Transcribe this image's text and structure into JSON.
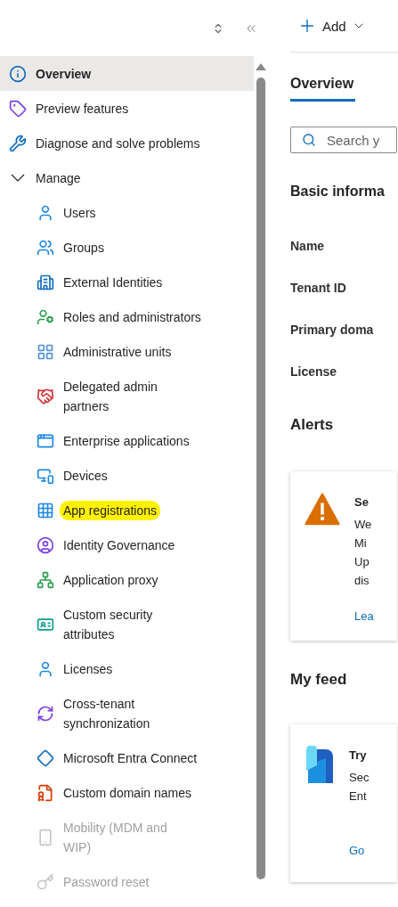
{
  "sidebar": {
    "items": [
      {
        "label": "Overview",
        "selected": true
      },
      {
        "label": "Preview features",
        "selected": false
      },
      {
        "label": "Diagnose and solve problems",
        "selected": false
      },
      {
        "label": "Manage",
        "selected": false,
        "expanded": true,
        "children": [
          {
            "label": "Users",
            "selected": false,
            "disabled": false,
            "highlighted": false
          },
          {
            "label": "Groups",
            "selected": false,
            "disabled": false,
            "highlighted": false
          },
          {
            "label": "External Identities",
            "selected": false,
            "disabled": false,
            "highlighted": false
          },
          {
            "label": "Roles and administrators",
            "selected": false,
            "disabled": false,
            "highlighted": false
          },
          {
            "label": "Administrative units",
            "selected": false,
            "disabled": false,
            "highlighted": false
          },
          {
            "label": "Delegated admin\npartners",
            "selected": false,
            "disabled": false,
            "highlighted": false
          },
          {
            "label": "Enterprise applications",
            "selected": false,
            "disabled": false,
            "highlighted": false
          },
          {
            "label": "Devices",
            "selected": false,
            "disabled": false,
            "highlighted": false
          },
          {
            "label": "App registrations",
            "selected": false,
            "disabled": false,
            "highlighted": true
          },
          {
            "label": "Identity Governance",
            "selected": false,
            "disabled": false,
            "highlighted": false
          },
          {
            "label": "Application proxy",
            "selected": false,
            "disabled": false,
            "highlighted": false
          },
          {
            "label": "Custom security\nattributes",
            "selected": false,
            "disabled": false,
            "highlighted": false
          },
          {
            "label": "Licenses",
            "selected": false,
            "disabled": false,
            "highlighted": false
          },
          {
            "label": "Cross-tenant\nsynchronization",
            "selected": false,
            "disabled": false,
            "highlighted": false
          },
          {
            "label": "Microsoft Entra Connect",
            "selected": false,
            "disabled": false,
            "highlighted": false
          },
          {
            "label": "Custom domain names",
            "selected": false,
            "disabled": false,
            "highlighted": false
          },
          {
            "label": "Mobility (MDM and\nWIP)",
            "selected": false,
            "disabled": true,
            "highlighted": false
          },
          {
            "label": "Password reset",
            "selected": false,
            "disabled": true,
            "highlighted": false
          }
        ]
      }
    ]
  },
  "toolbar": {
    "add_button": "Add"
  },
  "tabs": [
    {
      "label": "Overview",
      "selected": true
    }
  ],
  "search": {
    "placeholder": "Search y"
  },
  "basic_info": {
    "heading": "Basic informa",
    "labels": [
      "Name",
      "Tenant ID",
      "Primary doma",
      "License"
    ]
  },
  "alerts": {
    "heading": "Alerts",
    "card": {
      "title": "Se",
      "lines": [
        "We",
        "Mi",
        "Up",
        "dis"
      ],
      "link": "Lea"
    }
  },
  "feed": {
    "heading": "My feed",
    "card": {
      "title": "Try",
      "lines": [
        "Sec",
        "Ent"
      ],
      "link": "Go"
    }
  }
}
